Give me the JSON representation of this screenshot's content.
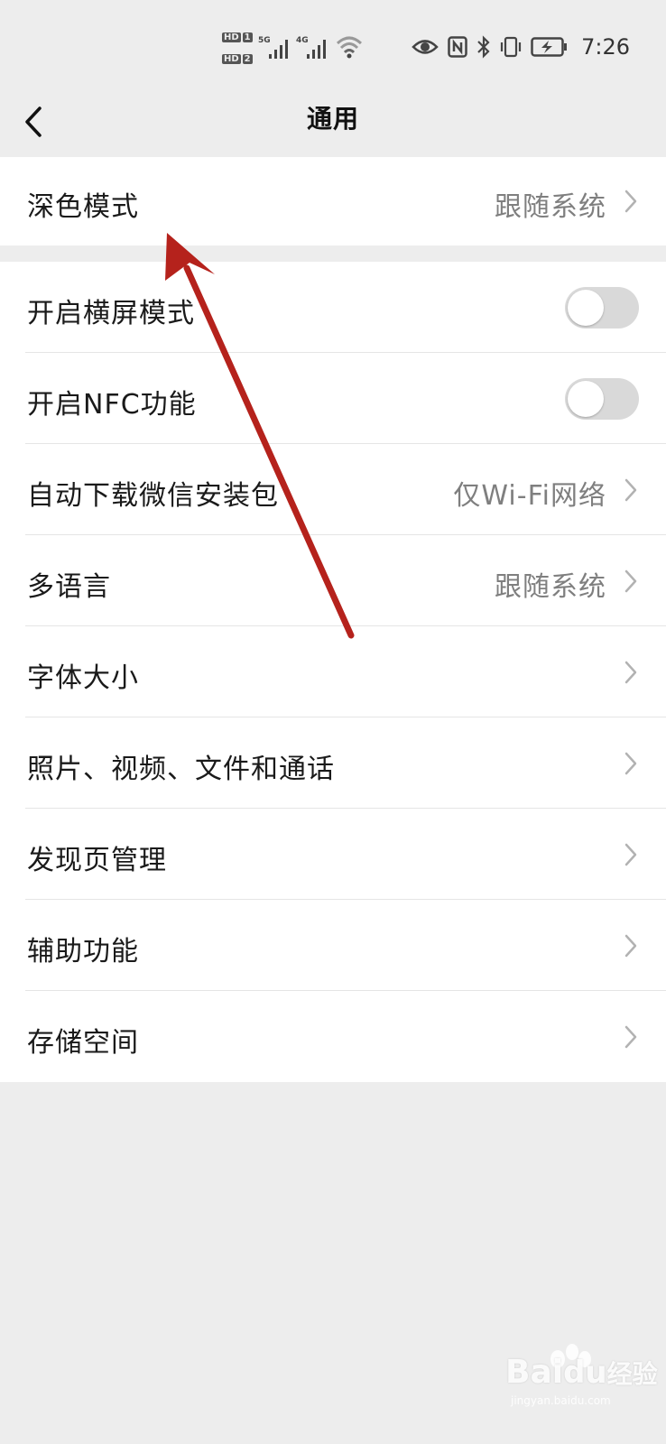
{
  "status_bar": {
    "sim1_badge": "HD",
    "sim1_index": "1",
    "sim2_badge": "HD",
    "sim2_index": "2",
    "sim1_network": "5G",
    "sim2_network": "4G",
    "time": "7:26",
    "icons": [
      "signal-icon",
      "signal-icon",
      "wifi-icon",
      "eye-icon",
      "nfc-icon",
      "bluetooth-icon",
      "vibrate-icon",
      "battery-charging-icon"
    ]
  },
  "nav": {
    "title": "通用",
    "back_icon": "back-chevron-icon"
  },
  "dark_mode": {
    "label": "深色模式",
    "value": "跟随系统"
  },
  "settings": {
    "landscape": {
      "label": "开启横屏模式",
      "enabled": false
    },
    "nfc": {
      "label": "开启NFC功能",
      "enabled": false
    },
    "auto_download": {
      "label": "自动下载微信安装包",
      "value": "仅Wi-Fi网络"
    },
    "language": {
      "label": "多语言",
      "value": "跟随系统"
    },
    "font_size": {
      "label": "字体大小"
    },
    "media": {
      "label": "照片、视频、文件和通话"
    },
    "discover": {
      "label": "发现页管理"
    },
    "accessibility": {
      "label": "辅助功能"
    },
    "storage": {
      "label": "存储空间"
    }
  },
  "annotation": {
    "arrow_color": "#b5221c"
  },
  "watermark": {
    "brand": "Bai",
    "brand_tail": "经验",
    "sub": "jingyan.baidu.com"
  },
  "colors": {
    "background": "#ededed",
    "card": "#ffffff",
    "secondary_text": "#7f7f7f",
    "toggle_off": "#d9d9d9"
  }
}
